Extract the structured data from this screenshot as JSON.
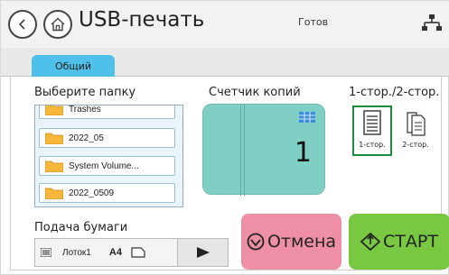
{
  "header": {
    "title": "USB-печать",
    "status": "Готов",
    "back_icon": "chevron-left-icon",
    "home_icon": "home-icon",
    "network_icon": "network-icon"
  },
  "tabs": [
    {
      "label": "Общий",
      "active": true
    }
  ],
  "folder_section": {
    "label": "Выберите папку",
    "items": [
      {
        "name": "Trashes"
      },
      {
        "name": "2022_05"
      },
      {
        "name": "System Volume..."
      },
      {
        "name": "2022_0509"
      }
    ]
  },
  "copies": {
    "label": "Счетчик копий",
    "value": "1"
  },
  "duplex": {
    "label": "1-стор./2-стор.",
    "options": [
      {
        "label": "1-стор.",
        "selected": true
      },
      {
        "label": "2-стор.",
        "selected": false
      }
    ]
  },
  "paper": {
    "label": "Подача бумаги",
    "tray": "Лоток1",
    "size": "A4"
  },
  "actions": {
    "cancel_label": "Отмена",
    "start_label": "СТАРТ"
  },
  "colors": {
    "tab": "#4fc0ea",
    "counter": "#7fcfc4",
    "selected_border": "#1e8a3c",
    "cancel": "#ef8fa5",
    "start": "#79c841"
  }
}
